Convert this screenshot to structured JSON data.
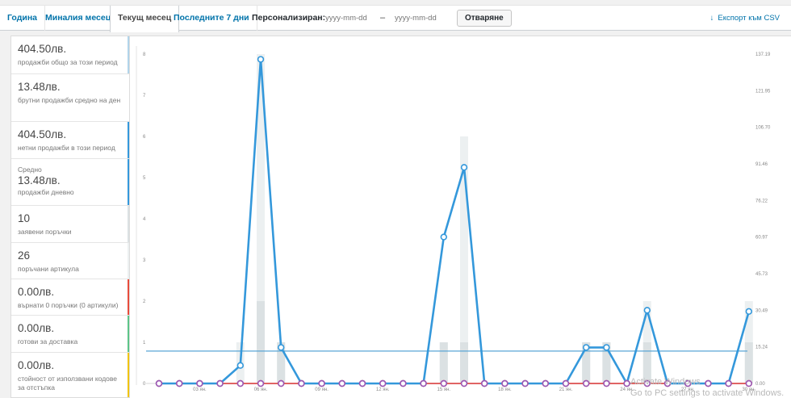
{
  "tabs": [
    {
      "label": "Година"
    },
    {
      "label": "Миналия месец"
    },
    {
      "label": "Текущ месец"
    },
    {
      "label": "Последните 7 дни"
    }
  ],
  "custom_range": {
    "label": "Персонализиран:",
    "from_placeholder": "yyyy-mm-dd",
    "separator": "–",
    "to_placeholder": "yyyy-mm-dd",
    "open_button": "Отваряне"
  },
  "export": {
    "label": "Експорт към CSV",
    "icon": "download-arrow-icon"
  },
  "stats": [
    {
      "amount": "404.50лв.",
      "desc": "продажби общо за този период",
      "color": "#b1d4ea"
    },
    {
      "amount": "13.48лв.",
      "desc": "брутни продажби средно на ден",
      "color": ""
    },
    {
      "amount": "404.50лв.",
      "desc": "нетни продажби в този период",
      "color": "#3498db"
    },
    {
      "pre": "Средно",
      "amount": "13.48лв.",
      "desc": "продажби дневно",
      "color": "#3498db"
    },
    {
      "amount": "10",
      "desc": "заявени поръчки",
      "color": "#dbe1e3"
    },
    {
      "amount": "26",
      "desc": "поръчани артикула",
      "color": "#ecf0f1"
    },
    {
      "amount": "0.00лв.",
      "desc": "върнати 0 поръчки (0 артикули)",
      "color": "#e74c3c"
    },
    {
      "amount": "0.00лв.",
      "desc": "готови за доставка",
      "color": "#5cc488"
    },
    {
      "amount": "0.00лв.",
      "desc": "стойност от използвани кодове за отстъпка",
      "color": "#f1c40f"
    }
  ],
  "watermark": {
    "line1": "Activate Windows",
    "line2": "Go to PC settings to activate Windows."
  },
  "chart_data": {
    "type": "line",
    "x": [
      "01 ян.",
      "02 ян.",
      "03 ян.",
      "04 ян.",
      "05 ян.",
      "06 ян.",
      "07 ян.",
      "08 ян.",
      "09 ян.",
      "10 ян.",
      "11 ян.",
      "12 ян.",
      "13 ян.",
      "14 ян.",
      "15 ян.",
      "16 ян.",
      "17 ян.",
      "18 ян.",
      "19 ян.",
      "20 ян.",
      "21 ян.",
      "22 ян.",
      "23 ян.",
      "24 ян.",
      "25 ян.",
      "26 ян.",
      "27 ян.",
      "28 ян.",
      "29 ян.",
      "30 ян."
    ],
    "x_tick_labels": [
      "03 ян.",
      "06 ян.",
      "09 ян.",
      "12 ян.",
      "15 ян.",
      "18 ян.",
      "21 ян.",
      "24 ян.",
      "27 ян.",
      "30 ян."
    ],
    "left_axis": {
      "ylim": [
        0,
        8
      ],
      "ticks": [
        "0",
        "1",
        "2",
        "3",
        "4",
        "5",
        "6",
        "7",
        "8"
      ]
    },
    "right_axis": {
      "ylim": [
        0,
        137.19
      ],
      "ticks": [
        "0.00",
        "15.24",
        "30.49",
        "45.73",
        "60.97",
        "76.22",
        "91.46",
        "106.70",
        "121.95",
        "137.19"
      ]
    },
    "series": [
      {
        "kind": "bar",
        "axis": "left",
        "color": "#ecf0f1",
        "values": [
          0,
          0,
          0,
          0,
          1,
          8,
          1,
          0,
          0,
          0,
          0,
          0,
          0,
          0,
          1,
          6,
          0,
          0,
          0,
          0,
          0,
          1,
          1,
          0,
          2,
          0,
          0,
          0,
          0,
          2
        ]
      },
      {
        "kind": "bar",
        "axis": "left",
        "color": "#dbe1e3",
        "values": [
          0,
          0,
          0,
          0,
          0,
          2,
          1,
          0,
          0,
          0,
          0,
          0,
          0,
          0,
          1,
          1,
          0,
          0,
          0,
          0,
          0,
          1,
          1,
          0,
          1,
          0,
          0,
          0,
          0,
          1
        ]
      },
      {
        "kind": "line",
        "axis": "right",
        "color": "#3498db",
        "values": [
          0,
          0,
          0,
          0,
          7.5,
          135,
          15,
          0,
          0,
          0,
          0,
          0,
          0,
          0,
          61,
          90,
          0,
          0,
          0,
          0,
          0,
          15,
          15,
          0,
          30.5,
          0,
          0,
          0,
          0,
          30
        ]
      },
      {
        "kind": "hline",
        "axis": "right",
        "color": "#5aa6d6",
        "value": 13.48
      },
      {
        "kind": "line",
        "axis": "right",
        "color": "#e74c3c",
        "values": [
          0,
          0,
          0,
          0,
          0,
          0,
          0,
          0,
          0,
          0,
          0,
          0,
          0,
          0,
          0,
          0,
          0,
          0,
          0,
          0,
          0,
          0,
          0,
          0,
          0,
          0,
          0,
          0,
          0,
          0
        ]
      },
      {
        "kind": "line",
        "axis": "right",
        "color": "#9b59b6",
        "values": [
          0,
          0,
          0,
          0,
          0,
          0,
          0,
          0,
          0,
          0,
          0,
          0,
          0,
          0,
          0,
          0,
          0,
          0,
          0,
          0,
          0,
          0,
          0,
          0,
          0,
          0,
          0,
          0,
          0,
          0
        ]
      }
    ]
  }
}
